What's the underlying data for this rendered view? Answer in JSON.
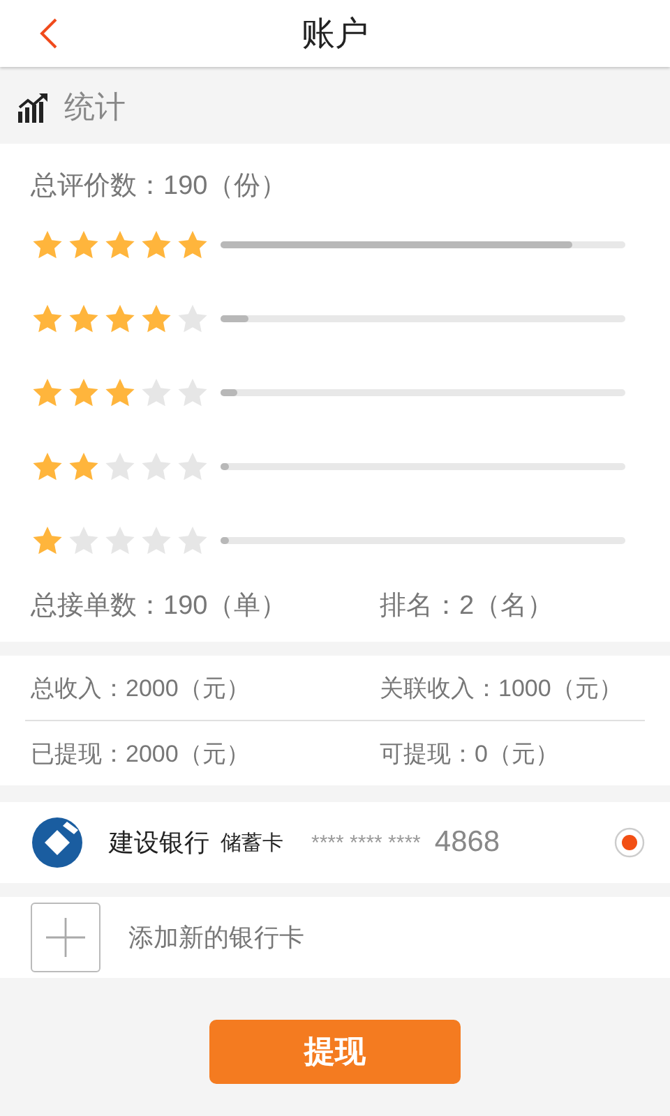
{
  "header": {
    "title": "账户"
  },
  "stats": {
    "title": "统计",
    "total_reviews": "总评价数：190（份）",
    "ratings": [
      {
        "stars": 5,
        "level": 0.87
      },
      {
        "stars": 4,
        "level": 0.07
      },
      {
        "stars": 3,
        "level": 0.04
      },
      {
        "stars": 2,
        "level": 0.02
      },
      {
        "stars": 1,
        "level": 0.02
      }
    ],
    "total_orders": "总接单数：190（单）",
    "rank": "排名：2（名）"
  },
  "income": [
    {
      "label": "总收入：2000（元）"
    },
    {
      "label": "关联收入：1000（元）"
    },
    {
      "label": "已提现：2000（元）"
    },
    {
      "label": "可提现：0（元）"
    }
  ],
  "bank_card": {
    "bank": "建设银行",
    "type": "储蓄卡",
    "mask": "**** **** ****",
    "last_digits": "4868",
    "selected": true
  },
  "add_card": {
    "label": "添加新的银行卡"
  },
  "withdraw_button": "提现"
}
